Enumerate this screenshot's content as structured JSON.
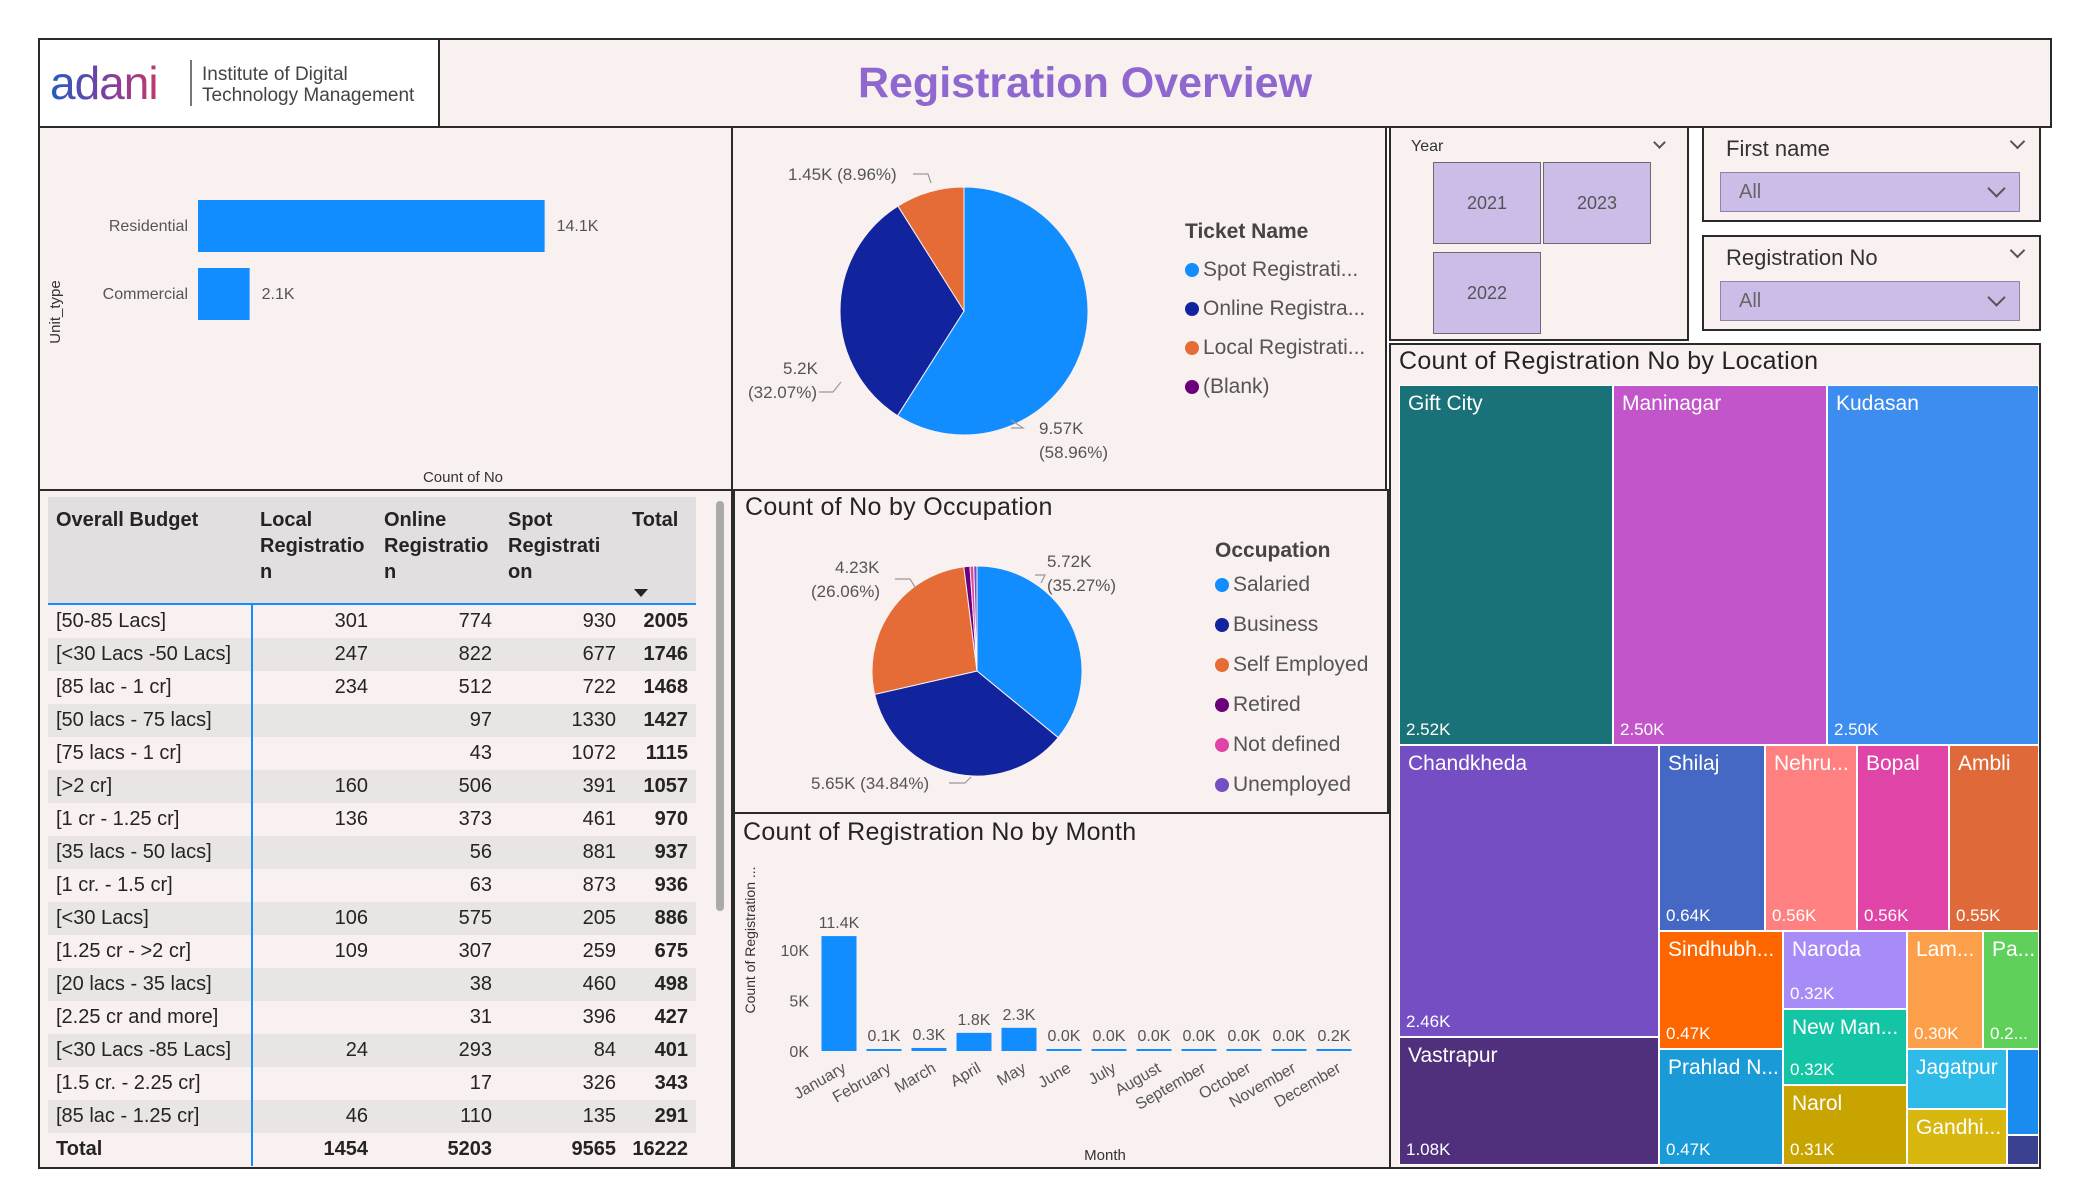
{
  "header": {
    "logo_brand": "adani",
    "logo_line1": "Institute of Digital",
    "logo_line2": "Technology Management",
    "title": "Registration Overview"
  },
  "unit_chart": {
    "y_axis_label": "Unit_type",
    "x_axis_label": "Count of No",
    "chart_data": {
      "type": "bar",
      "orientation": "horizontal",
      "categories": [
        "Residential",
        "Commercial"
      ],
      "values": [
        14100,
        2100
      ],
      "labels": [
        "14.1K",
        "2.1K"
      ],
      "xlabel": "Count of No",
      "ylabel": "Unit_type",
      "xlim": [
        0,
        24000
      ],
      "grid": false,
      "color": "#118dff"
    }
  },
  "ticket_chart": {
    "legend_title": "Ticket Name",
    "chart_data": {
      "type": "pie",
      "categories": [
        "Spot Registrati...",
        "Online Registra...",
        "Local Registrati...",
        "(Blank)"
      ],
      "values": [
        9570,
        5200,
        1450,
        0
      ],
      "labels": [
        "9.57K\n(58.96%)",
        "5.2K\n(32.07%)",
        "1.45K (8.96%)",
        ""
      ],
      "colors": [
        "#118dff",
        "#12239e",
        "#e66c37",
        "#6b007b"
      ],
      "legend": "right"
    }
  },
  "occupation_chart": {
    "title": "Count of No by Occupation",
    "legend_title": "Occupation",
    "chart_data": {
      "type": "pie",
      "categories": [
        "Salaried",
        "Business",
        "Self Employed",
        "Retired",
        "Not defined",
        "Unemployed"
      ],
      "values": [
        5720,
        5650,
        4230,
        150,
        90,
        80
      ],
      "labels": [
        "5.72K\n(35.27%)",
        "5.65K (34.84%)",
        "4.23K\n(26.06%)",
        "",
        "",
        ""
      ],
      "colors": [
        "#118dff",
        "#12239e",
        "#e66c37",
        "#6b007b",
        "#e044a7",
        "#744ec2"
      ],
      "legend": "right"
    }
  },
  "month_chart": {
    "title": "Count of Registration No by Month",
    "y_axis_label": "Count of Registration ...",
    "x_axis_label": "Month",
    "chart_data": {
      "type": "bar",
      "categories": [
        "January",
        "February",
        "March",
        "April",
        "May",
        "June",
        "July",
        "August",
        "September",
        "October",
        "November",
        "December"
      ],
      "values": [
        11400,
        100,
        300,
        1800,
        2300,
        0,
        0,
        0,
        0,
        0,
        0,
        200
      ],
      "labels": [
        "11.4K",
        "0.1K",
        "0.3K",
        "1.8K",
        "2.3K",
        "0.0K",
        "0.0K",
        "0.0K",
        "0.0K",
        "0.0K",
        "0.0K",
        "0.2K"
      ],
      "yticks": [
        "0K",
        "5K",
        "10K"
      ],
      "ylim": [
        0,
        12500
      ],
      "xlabel": "Month",
      "ylabel": "Count of Registration ...",
      "grid": false,
      "color": "#118dff"
    }
  },
  "budget_table": {
    "headers": [
      "Overall Budget",
      "Local Registratio n",
      "Online Registratio n",
      "Spot Registrati on",
      "Total"
    ],
    "header_lines": [
      [
        "Overall Budget"
      ],
      [
        "Local",
        "Registratio",
        "n"
      ],
      [
        "Online",
        "Registratio",
        "n"
      ],
      [
        "Spot",
        "Registrati",
        "on"
      ],
      [
        "Total"
      ]
    ],
    "rows": [
      [
        "[50-85 Lacs]",
        "301",
        "774",
        "930",
        "2005"
      ],
      [
        "[<30 Lacs -50 Lacs]",
        "247",
        "822",
        "677",
        "1746"
      ],
      [
        "[85 lac - 1 cr]",
        "234",
        "512",
        "722",
        "1468"
      ],
      [
        "[50 lacs - 75 lacs]",
        "",
        "97",
        "1330",
        "1427"
      ],
      [
        "[75 lacs - 1 cr]",
        "",
        "43",
        "1072",
        "1115"
      ],
      [
        "[>2 cr]",
        "160",
        "506",
        "391",
        "1057"
      ],
      [
        "[1 cr - 1.25 cr]",
        "136",
        "373",
        "461",
        "970"
      ],
      [
        "[35 lacs - 50 lacs]",
        "",
        "56",
        "881",
        "937"
      ],
      [
        "[1 cr. - 1.5 cr]",
        "",
        "63",
        "873",
        "936"
      ],
      [
        "[<30 Lacs]",
        "106",
        "575",
        "205",
        "886"
      ],
      [
        "[1.25 cr - >2 cr]",
        "109",
        "307",
        "259",
        "675"
      ],
      [
        "[20 lacs - 35 lacs]",
        "",
        "38",
        "460",
        "498"
      ],
      [
        "[2.25 cr and more]",
        "",
        "31",
        "396",
        "427"
      ],
      [
        "[<30 Lacs -85 Lacs]",
        "24",
        "293",
        "84",
        "401"
      ],
      [
        "[1.5 cr. - 2.25 cr]",
        "",
        "17",
        "326",
        "343"
      ],
      [
        "[85 lac - 1.25 cr]",
        "46",
        "110",
        "135",
        "291"
      ]
    ],
    "total_row": [
      "Total",
      "1454",
      "5203",
      "9565",
      "16222"
    ]
  },
  "year_slicer": {
    "label": "Year",
    "options": [
      "2021",
      "2023",
      "2022"
    ]
  },
  "firstname_slicer": {
    "label": "First name",
    "value": "All"
  },
  "regno_slicer": {
    "label": "Registration No",
    "value": "All"
  },
  "treemap": {
    "title": "Count of Registration No by Location",
    "tiles": [
      {
        "label": "Gift City",
        "value": "2.52K",
        "color": "#197278"
      },
      {
        "label": "Maninagar",
        "value": "2.50K",
        "color": "#c155c9"
      },
      {
        "label": "Kudasan",
        "value": "2.50K",
        "color": "#3d8cf0"
      },
      {
        "label": "Chandkheda",
        "value": "2.46K",
        "color": "#744ec2"
      },
      {
        "label": "Shilaj",
        "value": "0.64K",
        "color": "#4668c5"
      },
      {
        "label": "Nehru...",
        "value": "0.56K",
        "color": "#fe8080"
      },
      {
        "label": "Bopal",
        "value": "0.56K",
        "color": "#e044a7"
      },
      {
        "label": "Ambli",
        "value": "0.55K",
        "color": "#e0693a"
      },
      {
        "label": "Sindhubh...",
        "value": "0.47K",
        "color": "#fe6600"
      },
      {
        "label": "Naroda",
        "value": "0.32K",
        "color": "#a78cf7"
      },
      {
        "label": "Lam...",
        "value": "0.30K",
        "color": "#fc9f4a"
      },
      {
        "label": "Pa...",
        "value": "0.2...",
        "color": "#5fd15a"
      },
      {
        "label": "New Man...",
        "value": "0.32K",
        "color": "#14c5a5"
      },
      {
        "label": "Vastrapur",
        "value": "1.08K",
        "color": "#50307d"
      },
      {
        "label": "Prahlad N...",
        "value": "0.47K",
        "color": "#1a9ad6"
      },
      {
        "label": "Narol",
        "value": "0.31K",
        "color": "#c8a400"
      },
      {
        "label": "Jagatpur",
        "value": "",
        "color": "#2ebbe8"
      },
      {
        "label": "Gandhi...",
        "value": "",
        "color": "#d8b70f"
      },
      {
        "label": "",
        "value": "",
        "color": "#1a8cf0"
      }
    ]
  }
}
